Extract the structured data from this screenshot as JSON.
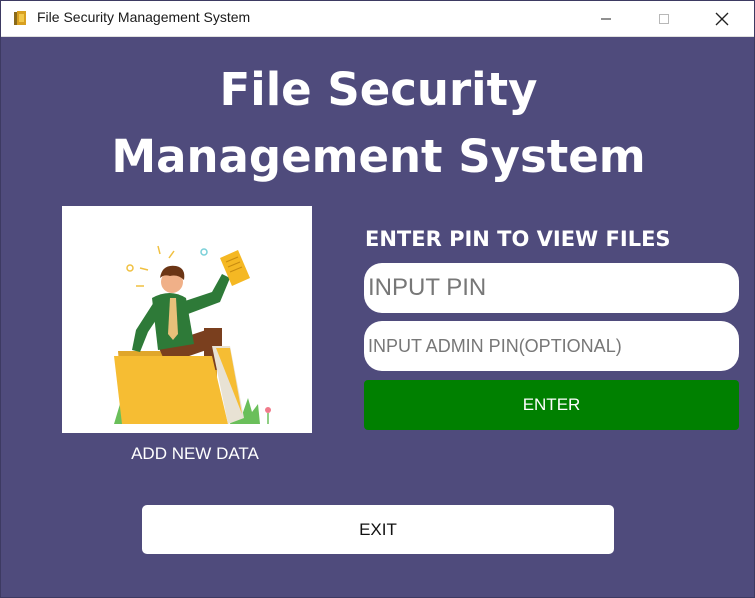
{
  "window": {
    "title": "File Security Management System",
    "app_icon": "folder-icon",
    "controls": [
      "minimize-icon",
      "maximize-icon",
      "close-icon"
    ]
  },
  "main": {
    "heading_line1": "File Security",
    "heading_line2": "Management System",
    "illustration_icon": "person-on-folder-illustration",
    "add_new_data_label": "ADD NEW DATA",
    "pin_label": "ENTER PIN TO VIEW FILES",
    "pin_placeholder": "INPUT PIN",
    "admin_pin_placeholder": "INPUT ADMIN PIN(OPTIONAL)",
    "enter_label": "ENTER",
    "exit_label": "EXIT"
  },
  "colors": {
    "background": "#4f4b7c",
    "enter_button": "#008000",
    "text": "#ffffff"
  }
}
